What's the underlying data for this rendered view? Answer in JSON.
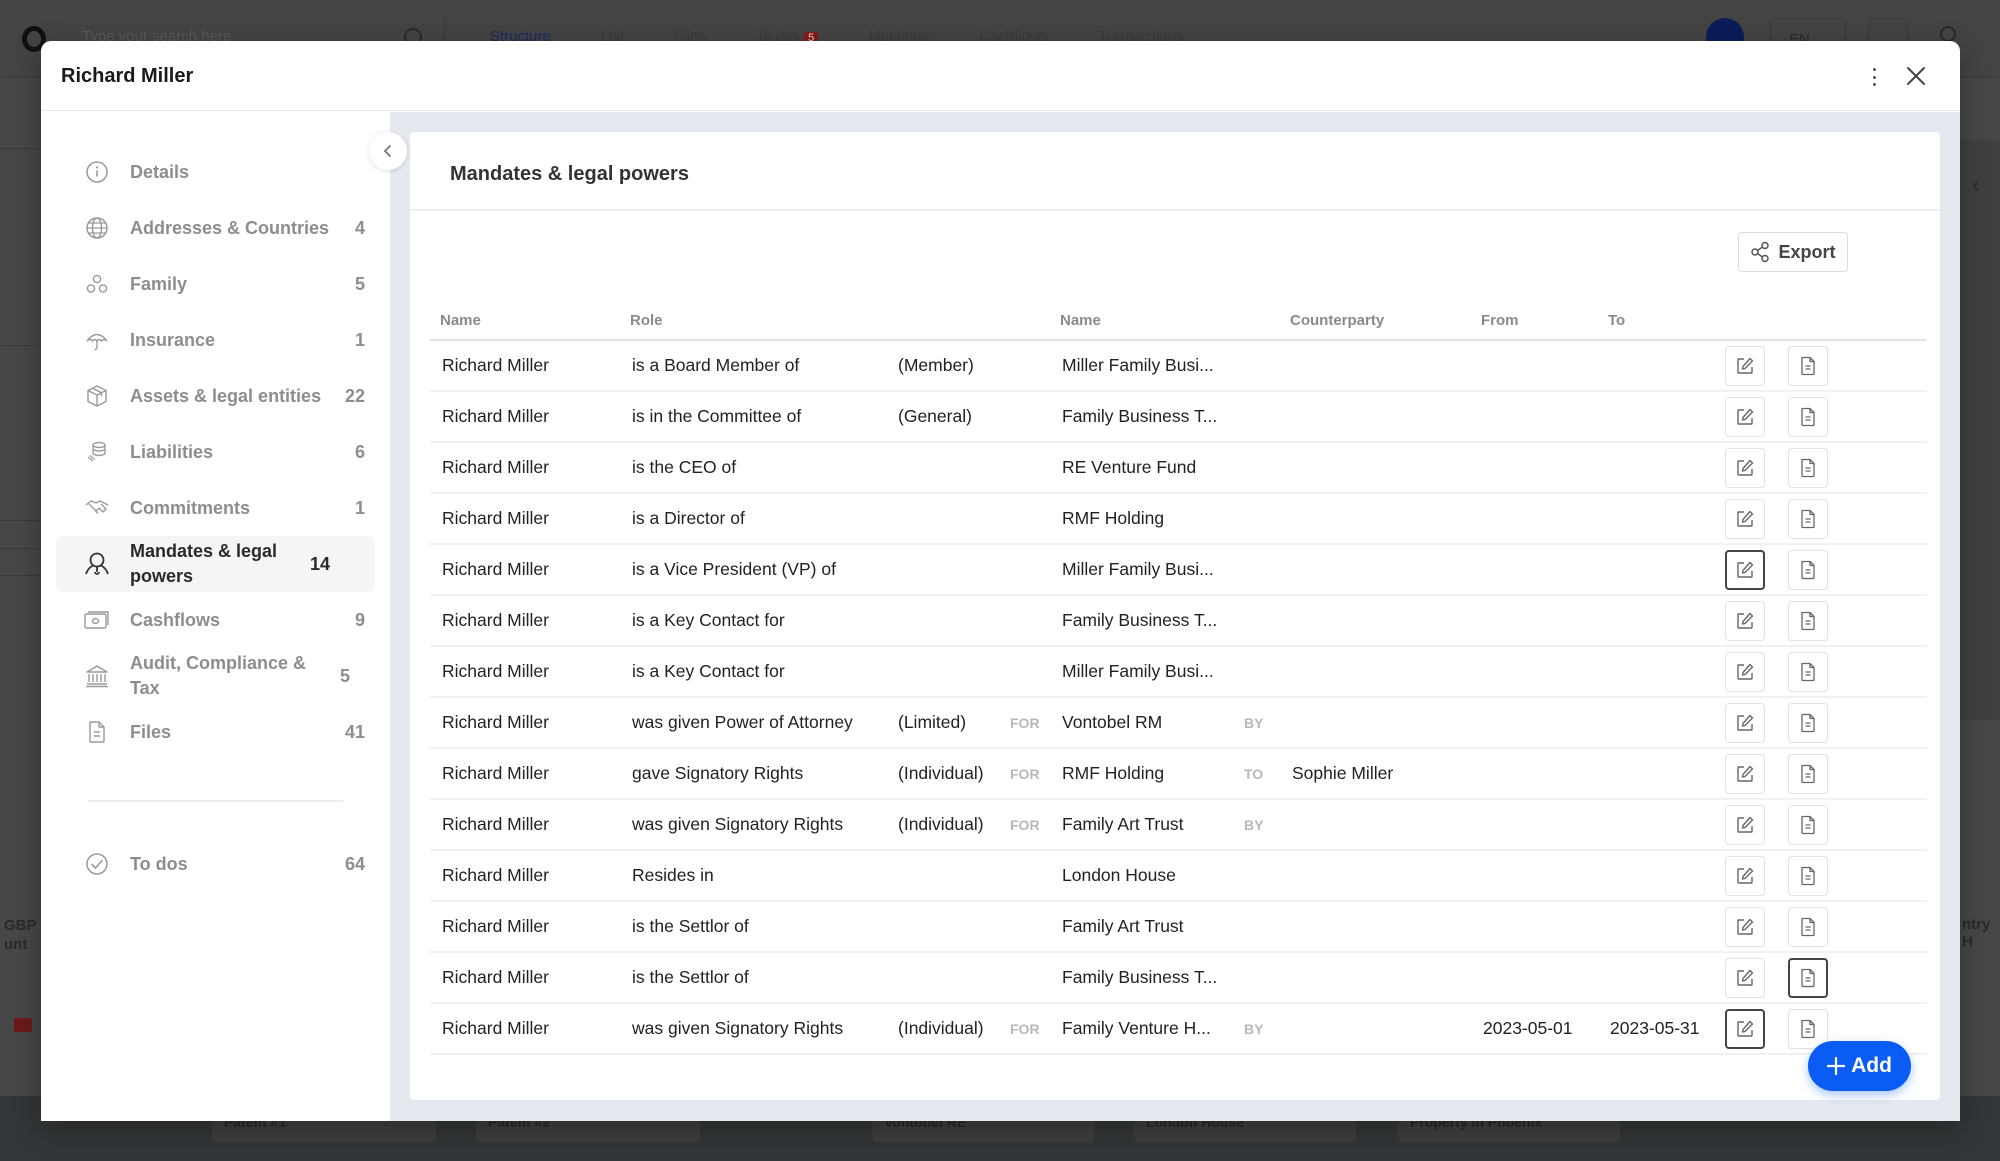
{
  "background": {
    "search_placeholder": "Type your search here",
    "nav": [
      {
        "label": "Structure",
        "active": true
      },
      {
        "label": "List"
      },
      {
        "label": "Files"
      },
      {
        "label": "To dos",
        "badge": "5"
      },
      {
        "label": "Meetings"
      },
      {
        "label": "Cashflows"
      },
      {
        "label": "Transactions"
      }
    ],
    "language": "EN",
    "cards": [
      "Patent #1",
      "Patent #2",
      "Vontobel RE",
      "London House",
      "Property in Phoenix"
    ],
    "side_text_left": "GBP\nunt",
    "side_text_right": "ntry H"
  },
  "modal": {
    "title": "Richard Miller",
    "sidebar": {
      "items": [
        {
          "label": "Details",
          "count": "",
          "icon": "info-icon"
        },
        {
          "label": "Addresses & Countries",
          "count": "4",
          "icon": "globe-icon"
        },
        {
          "label": "Family",
          "count": "5",
          "icon": "family-icon"
        },
        {
          "label": "Insurance",
          "count": "1",
          "icon": "umbrella-icon"
        },
        {
          "label": "Assets & legal entities",
          "count": "22",
          "icon": "box-icon"
        },
        {
          "label": "Liabilities",
          "count": "6",
          "icon": "coins-icon"
        },
        {
          "label": "Commitments",
          "count": "1",
          "icon": "handshake-icon"
        },
        {
          "label": "Mandates & legal powers",
          "count": "14",
          "icon": "award-icon",
          "active": true
        },
        {
          "label": "Cashflows",
          "count": "9",
          "icon": "cash-icon"
        },
        {
          "label": "Audit, Compliance & Tax",
          "count": "5",
          "icon": "bank-icon"
        },
        {
          "label": "Files",
          "count": "41",
          "icon": "file-icon"
        }
      ],
      "todos": {
        "label": "To dos",
        "count": "64",
        "icon": "check-circle-icon"
      }
    },
    "section": {
      "title": "Mandates & legal powers",
      "export_label": "Export",
      "add_label": "Add",
      "columns": [
        "Name",
        "Role",
        "",
        "",
        "Name",
        "",
        "Counterparty",
        "From",
        "To",
        ""
      ],
      "rows": [
        {
          "name": "Richard Miller",
          "role": "is a Board Member of",
          "qualifier": "(Member)",
          "kw1": "",
          "target": "Miller Family Busi...",
          "kw2": "",
          "counterparty": "",
          "from": "",
          "to": ""
        },
        {
          "name": "Richard Miller",
          "role": "is in the Committee of",
          "qualifier": "(General)",
          "kw1": "",
          "target": "Family Business T...",
          "kw2": "",
          "counterparty": "",
          "from": "",
          "to": ""
        },
        {
          "name": "Richard Miller",
          "role": "is the CEO of",
          "qualifier": "",
          "kw1": "",
          "target": "RE Venture Fund",
          "kw2": "",
          "counterparty": "",
          "from": "",
          "to": ""
        },
        {
          "name": "Richard Miller",
          "role": "is a Director of",
          "qualifier": "",
          "kw1": "",
          "target": "RMF Holding",
          "kw2": "",
          "counterparty": "",
          "from": "",
          "to": ""
        },
        {
          "name": "Richard Miller",
          "role": "is a Vice President (VP) of",
          "qualifier": "",
          "kw1": "",
          "target": "Miller Family Busi...",
          "kw2": "",
          "counterparty": "",
          "from": "",
          "to": "",
          "focus": "edit"
        },
        {
          "name": "Richard Miller",
          "role": "is a Key Contact for",
          "qualifier": "",
          "kw1": "",
          "target": "Family Business T...",
          "kw2": "",
          "counterparty": "",
          "from": "",
          "to": ""
        },
        {
          "name": "Richard Miller",
          "role": "is a Key Contact for",
          "qualifier": "",
          "kw1": "",
          "target": "Miller Family Busi...",
          "kw2": "",
          "counterparty": "",
          "from": "",
          "to": ""
        },
        {
          "name": "Richard Miller",
          "role": "was given Power of Attorney",
          "qualifier": "(Limited)",
          "kw1": "FOR",
          "target": "Vontobel RM",
          "kw2": "BY",
          "counterparty": "",
          "from": "",
          "to": ""
        },
        {
          "name": "Richard Miller",
          "role": "gave Signatory Rights",
          "qualifier": "(Individual)",
          "kw1": "FOR",
          "target": "RMF Holding",
          "kw2": "TO",
          "counterparty": "Sophie Miller",
          "from": "",
          "to": ""
        },
        {
          "name": "Richard Miller",
          "role": "was given Signatory Rights",
          "qualifier": "(Individual)",
          "kw1": "FOR",
          "target": "Family Art Trust",
          "kw2": "BY",
          "counterparty": "",
          "from": "",
          "to": ""
        },
        {
          "name": "Richard Miller",
          "role": "Resides in",
          "qualifier": "",
          "kw1": "",
          "target": "London House",
          "kw2": "",
          "counterparty": "",
          "from": "",
          "to": ""
        },
        {
          "name": "Richard Miller",
          "role": "is the Settlor of",
          "qualifier": "",
          "kw1": "",
          "target": "Family Art Trust",
          "kw2": "",
          "counterparty": "",
          "from": "",
          "to": ""
        },
        {
          "name": "Richard Miller",
          "role": "is the Settlor of",
          "qualifier": "",
          "kw1": "",
          "target": "Family Business T...",
          "kw2": "",
          "counterparty": "",
          "from": "",
          "to": "",
          "focus": "doc"
        },
        {
          "name": "Richard Miller",
          "role": "was given Signatory Rights",
          "qualifier": "(Individual)",
          "kw1": "FOR",
          "target": "Family Venture H...",
          "kw2": "BY",
          "counterparty": "",
          "from": "2023-05-01",
          "to": "2023-05-31",
          "focus": "edit"
        }
      ]
    }
  },
  "colors": {
    "accent": "#0a5cf5",
    "content_bg": "#e4e9ef",
    "active_item_bg": "#f5f5f5"
  }
}
